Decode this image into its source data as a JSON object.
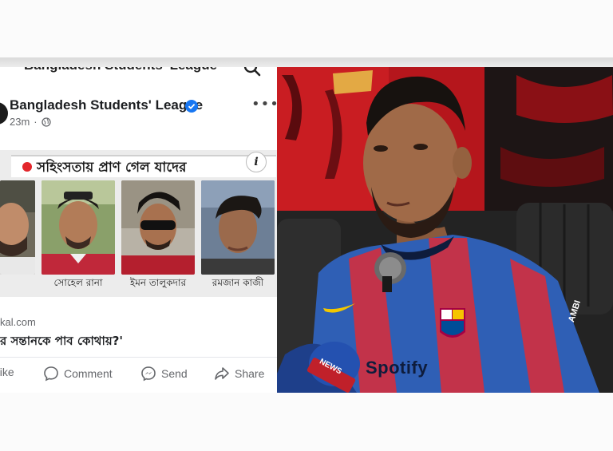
{
  "post": {
    "header_title": "Bangladesh Students' League",
    "page_name": "Bangladesh Students' League",
    "time": "23m",
    "more_label": "•••"
  },
  "news_card": {
    "banner_text": "সহিংসতায় প্রাণ গেল যাদের",
    "info_label": "i",
    "people": [
      {
        "name": ""
      },
      {
        "name": "সোহেল রানা"
      },
      {
        "name": "ইমন তালুকদার"
      },
      {
        "name": "রমজান কাজী"
      }
    ]
  },
  "link": {
    "domain": "kal.com",
    "title": "র সন্তানকে পাব কোথায়?'"
  },
  "actions": [
    {
      "label": "Like",
      "icon": "like-icon"
    },
    {
      "label": "Comment",
      "icon": "comment-icon"
    },
    {
      "label": "Send",
      "icon": "messenger-icon"
    },
    {
      "label": "Share",
      "icon": "share-icon"
    }
  ],
  "interview_photo": {
    "mic_label": "NEWS",
    "shirt_sponsor": "Spotify",
    "sleeve_text": "AMBI"
  },
  "colors": {
    "fb_blue": "#1877f2",
    "banner_dot": "#e3262b",
    "jersey_blue": "#2f5fb5",
    "jersey_red": "#c2334a",
    "backdrop_red": "#b5161c"
  }
}
